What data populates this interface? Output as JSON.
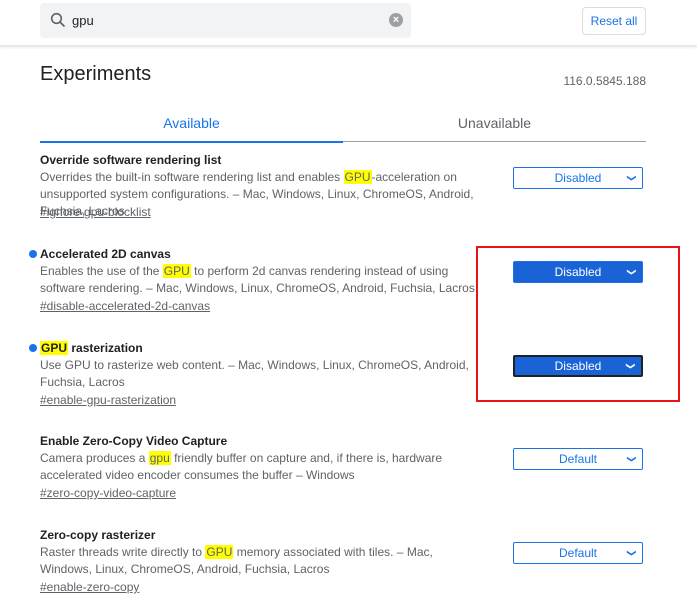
{
  "search": {
    "value": "gpu",
    "icon": "search-icon",
    "clear_icon": "clear-icon"
  },
  "reset_label": "Reset all",
  "page_title": "Experiments",
  "version": "116.0.5845.188",
  "tabs": [
    {
      "label": "Available",
      "active": true
    },
    {
      "label": "Unavailable",
      "active": false
    }
  ],
  "colors": {
    "accent": "#1a73e8",
    "highlight": "#ffff00",
    "annotation": "#e8141a"
  },
  "experiments": [
    {
      "title": {
        "pre": "",
        "hl": "",
        "post": "Override software rendering list"
      },
      "modified": false,
      "desc": {
        "pre": "Overrides the built-in software rendering list and enables ",
        "hl": "GPU",
        "post": "-acceleration on unsupported system configurations. – Mac, Windows, Linux, ChromeOS, Android, Fuchsia, Lacros"
      },
      "link": "#ignore-gpu-blocklist",
      "value": "Disabled"
    },
    {
      "title": {
        "pre": "",
        "hl": "",
        "post": "Accelerated 2D canvas"
      },
      "modified": true,
      "desc": {
        "pre": "Enables the use of the ",
        "hl": "GPU",
        "post": " to perform 2d canvas rendering instead of using software rendering. – Mac, Windows, Linux, ChromeOS, Android, Fuchsia, Lacros"
      },
      "link": "#disable-accelerated-2d-canvas",
      "value": "Disabled"
    },
    {
      "title": {
        "pre": "",
        "hl": "GPU",
        "post": " rasterization"
      },
      "modified": true,
      "desc": {
        "pre": "Use GPU to rasterize web content. – Mac, Windows, Linux, ChromeOS, Android, Fuchsia, Lacros",
        "hl": "",
        "post": ""
      },
      "link": "#enable-gpu-rasterization",
      "value": "Disabled"
    },
    {
      "title": {
        "pre": "",
        "hl": "",
        "post": "Enable Zero-Copy Video Capture"
      },
      "modified": false,
      "desc": {
        "pre": "Camera produces a ",
        "hl": "gpu",
        "post": " friendly buffer on capture and, if there is, hardware accelerated video encoder consumes the buffer – Windows"
      },
      "link": "#zero-copy-video-capture",
      "value": "Default"
    },
    {
      "title": {
        "pre": "",
        "hl": "",
        "post": "Zero-copy rasterizer"
      },
      "modified": false,
      "desc": {
        "pre": "Raster threads write directly to ",
        "hl": "GPU",
        "post": " memory associated with tiles. – Mac, Windows, Linux, ChromeOS, Android, Fuchsia, Lacros"
      },
      "link": "#enable-zero-copy",
      "value": "Default"
    }
  ]
}
